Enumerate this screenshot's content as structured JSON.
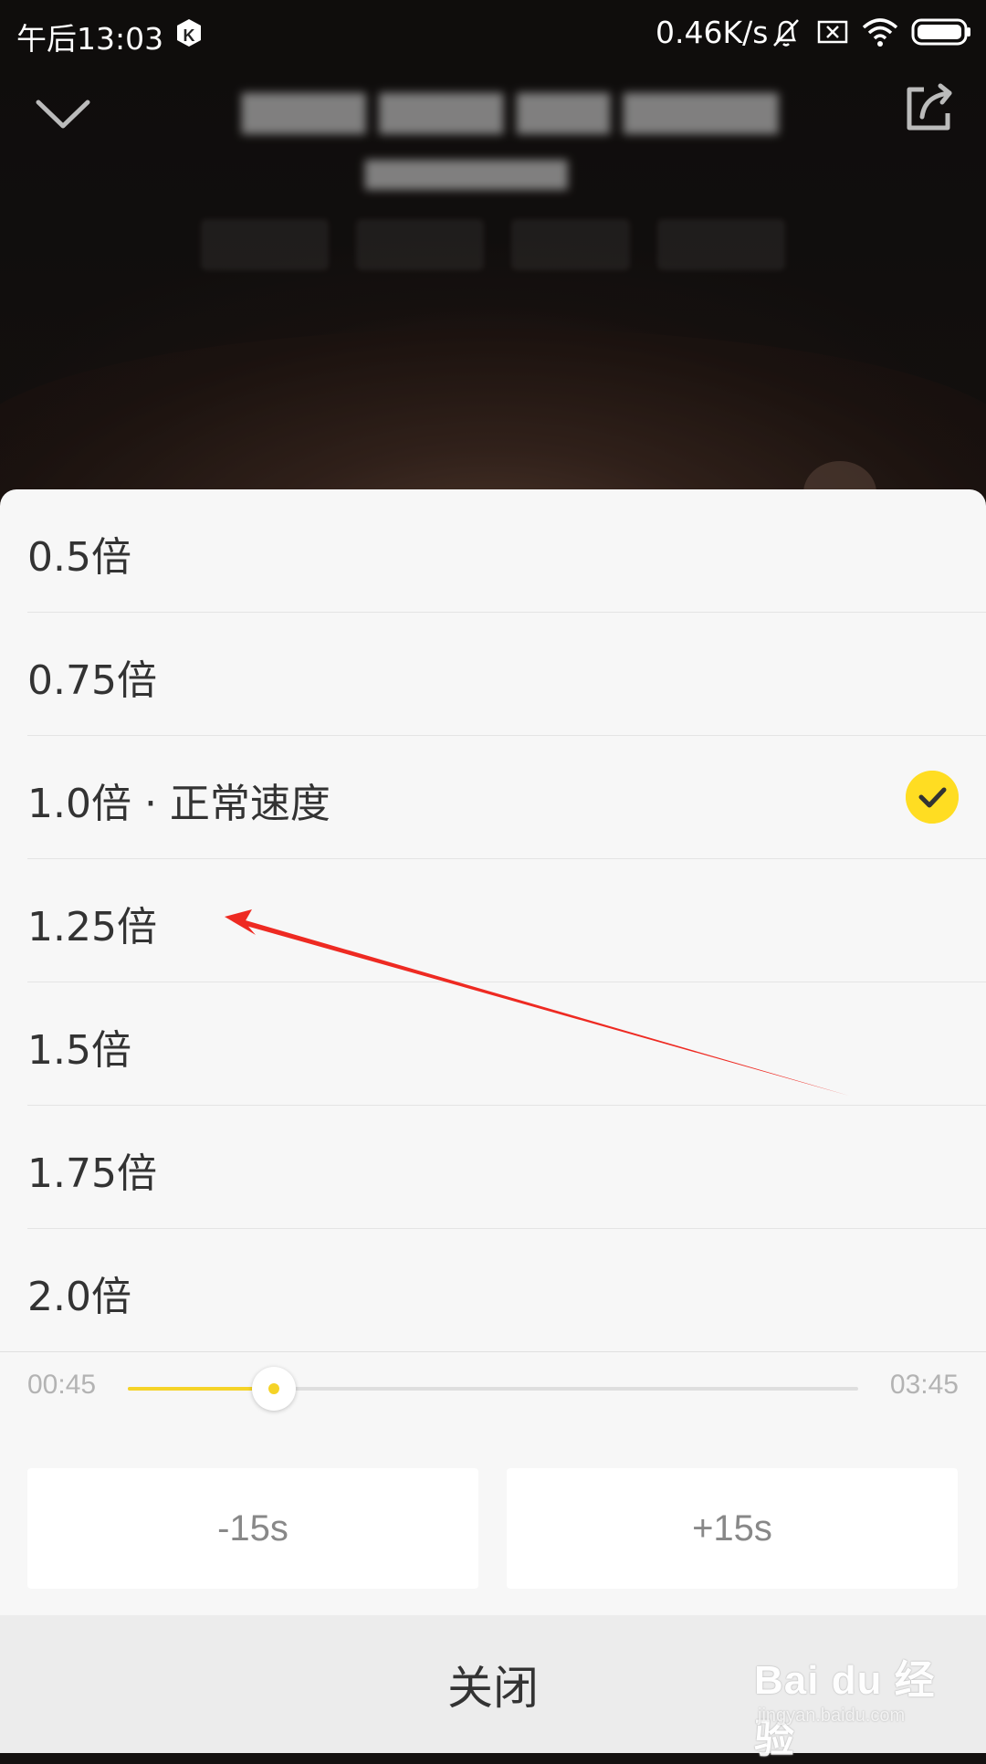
{
  "status_bar": {
    "time": "午后13:03",
    "net_speed": "0.46K/s",
    "icons": [
      "app-notification-icon",
      "mute-bell-icon",
      "sim-x-icon",
      "wifi-icon",
      "battery-icon"
    ]
  },
  "player_header": {
    "collapse_icon": "chevron-down-icon",
    "share_icon": "share-icon"
  },
  "speed_sheet": {
    "options": [
      {
        "label": "0.5倍",
        "selected": false
      },
      {
        "label": "0.75倍",
        "selected": false
      },
      {
        "label": "1.0倍 · 正常速度",
        "selected": true
      },
      {
        "label": "1.25倍",
        "selected": false
      },
      {
        "label": "1.5倍",
        "selected": false
      },
      {
        "label": "1.75倍",
        "selected": false
      },
      {
        "label": "2.0倍",
        "selected": false
      }
    ],
    "selected_icon": "checkmark-icon",
    "accent_color": "#f5d327"
  },
  "progress": {
    "current": "00:45",
    "total": "03:45",
    "fraction": 0.2
  },
  "seek_buttons": {
    "back": "-15s",
    "forward": "+15s"
  },
  "close_label": "关闭",
  "annotation": {
    "color": "#ee2a22"
  },
  "watermark": {
    "main": "Bai du 经验",
    "sub": "jingyan.baidu.com"
  }
}
